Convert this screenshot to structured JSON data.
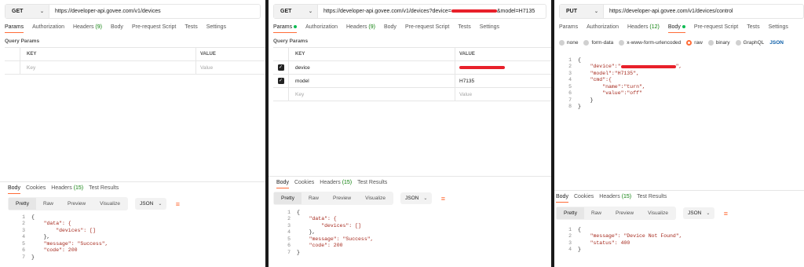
{
  "panel1": {
    "method": "GET",
    "url": "https://developer-api.govee.com/v1/devices",
    "tabs": [
      "Params",
      "Authorization",
      "Headers",
      "Body",
      "Pre-request Script",
      "Tests",
      "Settings"
    ],
    "headers_count": "(9)",
    "query_params_title": "Query Params",
    "table": {
      "key_header": "KEY",
      "value_header": "VALUE",
      "key_placeholder": "Key",
      "value_placeholder": "Value"
    },
    "response_tabs": [
      "Body",
      "Cookies",
      "Headers",
      "Test Results"
    ],
    "response_headers_count": "(15)",
    "view_buttons": [
      "Pretty",
      "Raw",
      "Preview",
      "Visualize"
    ],
    "format": "JSON",
    "code": [
      {
        "n": "1",
        "t": "{"
      },
      {
        "n": "2",
        "t": "    \"data\": {"
      },
      {
        "n": "3",
        "t": "        \"devices\": []"
      },
      {
        "n": "4",
        "t": "    },"
      },
      {
        "n": "5",
        "t": "    \"message\": \"Success\","
      },
      {
        "n": "6",
        "t": "    \"code\": 200"
      },
      {
        "n": "7",
        "t": "}"
      }
    ]
  },
  "panel2": {
    "method": "GET",
    "url_prefix": "https://developer-api.govee.com/v1/devices?device=",
    "url_suffix": "&model=H7135",
    "tabs": [
      "Params",
      "Authorization",
      "Headers",
      "Body",
      "Pre-request Script",
      "Tests",
      "Settings"
    ],
    "headers_count": "(9)",
    "query_params_title": "Query Params",
    "table": {
      "key_header": "KEY",
      "value_header": "VALUE",
      "rows": [
        {
          "key": "device",
          "value": ""
        },
        {
          "key": "model",
          "value": "H7135"
        }
      ],
      "key_placeholder": "Key",
      "value_placeholder": "Value"
    },
    "response_tabs": [
      "Body",
      "Cookies",
      "Headers",
      "Test Results"
    ],
    "response_headers_count": "(15)",
    "view_buttons": [
      "Pretty",
      "Raw",
      "Preview",
      "Visualize"
    ],
    "format": "JSON",
    "code": [
      {
        "n": "1",
        "t": "{"
      },
      {
        "n": "2",
        "t": "    \"data\": {"
      },
      {
        "n": "3",
        "t": "        \"devices\": []"
      },
      {
        "n": "4",
        "t": "    },"
      },
      {
        "n": "5",
        "t": "    \"message\": \"Success\","
      },
      {
        "n": "6",
        "t": "    \"code\": 200"
      },
      {
        "n": "7",
        "t": "}"
      }
    ]
  },
  "panel3": {
    "method": "PUT",
    "url": "https://developer-api.govee.com/v1/devices/control",
    "tabs": [
      "Params",
      "Authorization",
      "Headers",
      "Body",
      "Pre-request Script",
      "Tests",
      "Settings"
    ],
    "headers_count": "(12)",
    "body_types": [
      "none",
      "form-data",
      "x-www-form-urlencoded",
      "raw",
      "binary",
      "GraphQL"
    ],
    "body_format": "JSON",
    "body_code": [
      {
        "n": "1",
        "t": "{"
      },
      {
        "n": "2",
        "t": "    \"device\":\"",
        "redact": true,
        "t2": "\","
      },
      {
        "n": "3",
        "t": "    \"model\":\"H7135\","
      },
      {
        "n": "4",
        "t": "    \"cmd\":{"
      },
      {
        "n": "5",
        "t": "        \"name\":\"turn\","
      },
      {
        "n": "6",
        "t": "        \"value\":\"off\""
      },
      {
        "n": "7",
        "t": "    }"
      },
      {
        "n": "8",
        "t": "}"
      }
    ],
    "response_tabs": [
      "Body",
      "Cookies",
      "Headers",
      "Test Results"
    ],
    "response_headers_count": "(15)",
    "view_buttons": [
      "Pretty",
      "Raw",
      "Preview",
      "Visualize"
    ],
    "format": "JSON",
    "code": [
      {
        "n": "1",
        "t": "{"
      },
      {
        "n": "2",
        "t": "    \"message\": \"Device Not Found\","
      },
      {
        "n": "3",
        "t": "    \"status\": 400"
      },
      {
        "n": "4",
        "t": "}"
      }
    ]
  }
}
